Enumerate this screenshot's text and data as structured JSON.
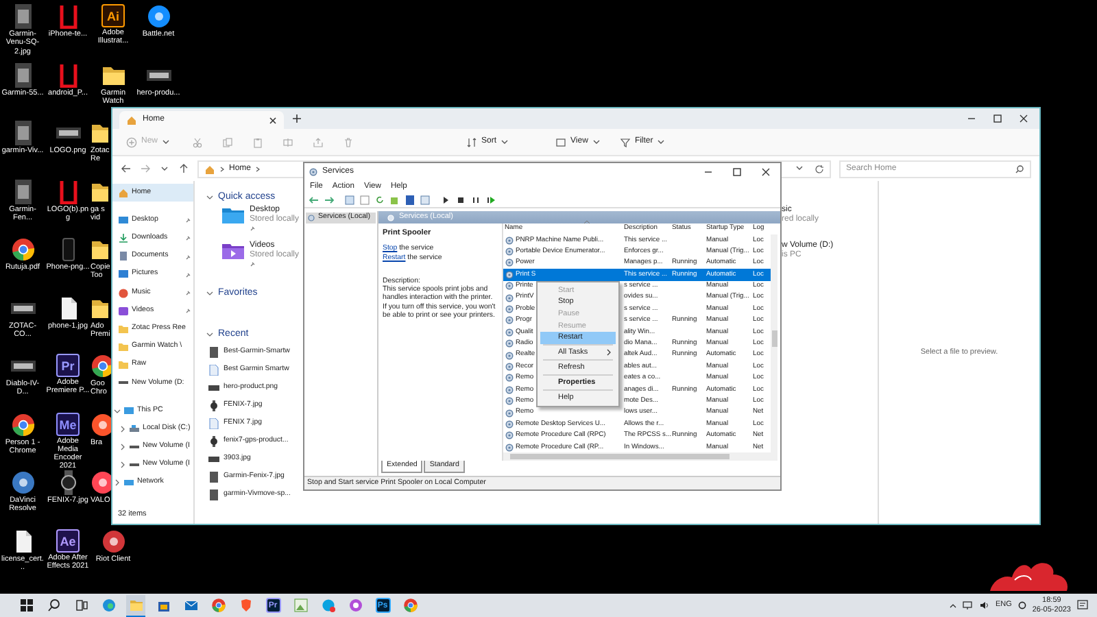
{
  "desktop": {
    "columns": [
      [
        {
          "label": "Garmin-Venu-SQ-2.jpg",
          "kind": "photo",
          "partial": false
        },
        {
          "label": "Garmin-55...",
          "kind": "photo",
          "partial": false
        },
        {
          "label": "garmin-Viv...",
          "kind": "photo",
          "partial": false
        },
        {
          "label": "Garmin-Fen...",
          "kind": "photo",
          "partial": false
        },
        {
          "label": "Rutuja.pdf",
          "kind": "browser",
          "partial": false
        },
        {
          "label": "ZOTAC-CO...",
          "kind": "banner",
          "partial": false
        },
        {
          "label": "Diablo-IV-D...",
          "kind": "banner",
          "partial": false
        },
        {
          "label": "Person 1 - Chrome",
          "kind": "browser",
          "partial": false
        },
        {
          "label": "DaVinci Resolve",
          "kind": "round",
          "color": "#3a78c2",
          "partial": false
        },
        {
          "label": "license_cert...",
          "kind": "doc",
          "partial": false
        }
      ],
      [
        {
          "label": "iPhone-te...",
          "kind": "frame",
          "partial": false
        },
        {
          "label": "android_P...",
          "kind": "frame",
          "partial": false
        },
        {
          "label": "LOGO.png",
          "kind": "banner",
          "partial": false
        },
        {
          "label": "LOGO(b).png",
          "kind": "frame",
          "partial": false
        },
        {
          "label": "Phone-png...",
          "kind": "phone",
          "partial": false
        },
        {
          "label": "phone-1.jpg",
          "kind": "doc",
          "partial": false
        },
        {
          "label": "Adobe Premiere P...",
          "kind": "logo",
          "logo": "Pr",
          "color": "#9999ff",
          "partial": false
        },
        {
          "label": "Adobe Media Encoder 2021",
          "kind": "logo",
          "logo": "Me",
          "color": "#8f8fff",
          "partial": false
        },
        {
          "label": "FENIX-7.jpg",
          "kind": "watch",
          "partial": false
        },
        {
          "label": "Adobe After Effects 2021",
          "kind": "logo",
          "logo": "Ae",
          "color": "#b09aff",
          "partial": false
        }
      ],
      [
        {
          "label": "Adobe Illustrat...",
          "kind": "logo",
          "logo": "Ai",
          "color": "#ff9a00",
          "partial": false
        },
        {
          "label": "Garmin Watch",
          "kind": "folder",
          "partial": false
        },
        {
          "label": "Zotac Re",
          "kind": "folder",
          "partial": true
        },
        {
          "label": "ga s vid",
          "kind": "folder",
          "partial": true
        },
        {
          "label": "Copie Too",
          "kind": "folder",
          "partial": true
        },
        {
          "label": "Ado Premi",
          "kind": "folder",
          "partial": true
        },
        {
          "label": "Goo Chro",
          "kind": "browser",
          "partial": true
        },
        {
          "label": "Bra",
          "kind": "round",
          "color": "#fb542b",
          "partial": true
        },
        {
          "label": "VALO",
          "kind": "round",
          "color": "#ff4655",
          "partial": true
        },
        {
          "label": "Riot Client",
          "kind": "round",
          "color": "#d13639",
          "partial": false
        }
      ],
      [
        {
          "label": "Battle.net",
          "kind": "round",
          "color": "#148eff",
          "partial": false
        },
        {
          "label": "hero-produ...",
          "kind": "banner",
          "partial": false
        }
      ]
    ]
  },
  "explorer": {
    "tab": {
      "label": "Home"
    },
    "toolbar": [
      {
        "label": "New",
        "kind": "new",
        "disabled": true
      },
      {
        "label": "Sort",
        "kind": "sort",
        "disabled": false
      },
      {
        "label": "View",
        "kind": "view",
        "disabled": false
      },
      {
        "label": "Filter",
        "kind": "filter",
        "disabled": false
      }
    ],
    "address": {
      "crumbs": [
        "Home"
      ]
    },
    "search": {
      "placeholder": "Search Home"
    },
    "nav": [
      {
        "label": "Home",
        "kind": "home",
        "pinned": false,
        "selected": true
      },
      {
        "label": "Desktop",
        "kind": "desktop",
        "pinned": true,
        "selected": false
      },
      {
        "label": "Downloads",
        "kind": "download",
        "pinned": true,
        "selected": false
      },
      {
        "label": "Documents",
        "kind": "documents",
        "pinned": true,
        "selected": false
      },
      {
        "label": "Pictures",
        "kind": "pictures",
        "pinned": true,
        "selected": false
      },
      {
        "label": "Music",
        "kind": "music",
        "pinned": true,
        "selected": false
      },
      {
        "label": "Videos",
        "kind": "videos",
        "pinned": true,
        "selected": false
      },
      {
        "label": "Zotac Press Ree",
        "kind": "folder",
        "pinned": false,
        "selected": false
      },
      {
        "label": "Garmin Watch \\",
        "kind": "folder",
        "pinned": false,
        "selected": false
      },
      {
        "label": "Raw",
        "kind": "folder",
        "pinned": false,
        "selected": false
      },
      {
        "label": "New Volume (D:",
        "kind": "drive",
        "pinned": false,
        "selected": false
      },
      {
        "label": "This PC",
        "kind": "pc",
        "pinned": false,
        "selected": false,
        "expanded": true,
        "children": [
          {
            "label": "Local Disk (C:)",
            "kind": "disk",
            "pinned": false,
            "selected": false,
            "expanded": false
          },
          {
            "label": "New Volume (I",
            "kind": "drive",
            "pinned": false,
            "selected": false,
            "expanded": false
          },
          {
            "label": "New Volume (I",
            "kind": "drive",
            "pinned": false,
            "selected": false,
            "expanded": false
          }
        ]
      },
      {
        "label": "Network",
        "kind": "network",
        "pinned": false,
        "selected": false,
        "expanded": false
      }
    ],
    "status": "32 items",
    "quick_access": {
      "title": "Quick access",
      "items": [
        {
          "name": "Desktop",
          "detail": "Stored locally",
          "kind": "desktop"
        },
        {
          "name": "Videos",
          "detail": "Stored locally",
          "kind": "videos"
        }
      ],
      "partial_items": [
        {
          "name": "sic",
          "detail": "red locally"
        },
        {
          "name": "w Volume (D:)",
          "detail": "is PC"
        }
      ]
    },
    "favorites": {
      "title": "Favorites"
    },
    "recent": {
      "title": "Recent",
      "items": [
        {
          "name": "Best-Garmin-Smartw",
          "kind": "photo"
        },
        {
          "name": "Best Garmin Smartw",
          "kind": "doc"
        },
        {
          "name": "hero-product.png",
          "kind": "banner"
        },
        {
          "name": "FENIX-7.jpg",
          "kind": "watch"
        },
        {
          "name": "FENIX 7.jpg",
          "kind": "doc"
        },
        {
          "name": "fenix7-gps-product...",
          "kind": "watch"
        },
        {
          "name": "3903.jpg",
          "kind": "banner"
        },
        {
          "name": "Garmin-Fenix-7.jpg",
          "kind": "photo"
        },
        {
          "name": "garmin-Vivmove-sp...",
          "kind": "photo"
        }
      ]
    },
    "preview": {
      "text": "Select a file to preview."
    }
  },
  "services": {
    "title": "Services",
    "menu": [
      "File",
      "Action",
      "View",
      "Help"
    ],
    "tree": [
      {
        "label": "Services (Local)",
        "selected": true
      }
    ],
    "pane_title": "Services (Local)",
    "detail": {
      "name": "Print Spooler",
      "actions": [
        {
          "link": "Stop",
          "text": " the service"
        },
        {
          "link": "Restart",
          "text": " the service"
        }
      ],
      "description_label": "Description:",
      "description": "This service spools print jobs and handles interaction with the printer. If you turn off this service, you won't be able to print or see your printers."
    },
    "columns": [
      "Name",
      "Description",
      "Status",
      "Startup Type",
      "Log"
    ],
    "rows": [
      {
        "name": "PNRP Machine Name Publi...",
        "description": "This service ...",
        "status": "",
        "startup": "Manual",
        "log": "Loc",
        "selected": false
      },
      {
        "name": "Portable Device Enumerator...",
        "description": "Enforces gr...",
        "status": "",
        "startup": "Manual (Trig...",
        "log": "Loc",
        "selected": false
      },
      {
        "name": "Power",
        "description": "Manages p...",
        "status": "Running",
        "startup": "Automatic",
        "log": "Loc",
        "selected": false
      },
      {
        "name": "Print S",
        "description": "This service ...",
        "status": "Running",
        "startup": "Automatic",
        "log": "Loc",
        "selected": true
      },
      {
        "name": "Printe",
        "description": "s service ...",
        "status": "",
        "startup": "Manual",
        "log": "Loc",
        "selected": false
      },
      {
        "name": "PrintV",
        "description": "ovides su...",
        "status": "",
        "startup": "Manual (Trig...",
        "log": "Loc",
        "selected": false
      },
      {
        "name": "Proble",
        "description": "s service ...",
        "status": "",
        "startup": "Manual",
        "log": "Loc",
        "selected": false
      },
      {
        "name": "Progr",
        "description": "s service ...",
        "status": "Running",
        "startup": "Manual",
        "log": "Loc",
        "selected": false
      },
      {
        "name": "Qualit",
        "description": "ality Win...",
        "status": "",
        "startup": "Manual",
        "log": "Loc",
        "selected": false
      },
      {
        "name": "Radio",
        "description": "dio Mana...",
        "status": "Running",
        "startup": "Manual",
        "log": "Loc",
        "selected": false
      },
      {
        "name": "Realte",
        "description": "altek Aud...",
        "status": "Running",
        "startup": "Automatic",
        "log": "Loc",
        "selected": false
      },
      {
        "name": "Recor",
        "description": "ables aut...",
        "status": "",
        "startup": "Manual",
        "log": "Loc",
        "selected": false
      },
      {
        "name": "Remo",
        "description": "eates a co...",
        "status": "",
        "startup": "Manual",
        "log": "Loc",
        "selected": false
      },
      {
        "name": "Remo",
        "description": "anages di...",
        "status": "Running",
        "startup": "Automatic",
        "log": "Loc",
        "selected": false
      },
      {
        "name": "Remo",
        "description": "mote Des...",
        "status": "",
        "startup": "Manual",
        "log": "Loc",
        "selected": false
      },
      {
        "name": "Remo",
        "description": "lows user...",
        "status": "",
        "startup": "Manual",
        "log": "Net",
        "selected": false
      },
      {
        "name": "Remote Desktop Services U...",
        "description": "Allows the r...",
        "status": "",
        "startup": "Manual",
        "log": "Loc",
        "selected": false
      },
      {
        "name": "Remote Procedure Call (RPC)",
        "description": "The RPCSS s...",
        "status": "Running",
        "startup": "Automatic",
        "log": "Net",
        "selected": false
      },
      {
        "name": "Remote Procedure Call (RP...",
        "description": "In Windows...",
        "status": "",
        "startup": "Manual",
        "log": "Net",
        "selected": false
      }
    ],
    "context_menu": [
      {
        "label": "Start",
        "disabled": true,
        "selected": false,
        "default": false,
        "submenu": false,
        "separator_after": false
      },
      {
        "label": "Stop",
        "disabled": false,
        "selected": false,
        "default": false,
        "submenu": false,
        "separator_after": false
      },
      {
        "label": "Pause",
        "disabled": true,
        "selected": false,
        "default": false,
        "submenu": false,
        "separator_after": false
      },
      {
        "label": "Resume",
        "disabled": true,
        "selected": false,
        "default": false,
        "submenu": false,
        "separator_after": false
      },
      {
        "label": "Restart",
        "disabled": false,
        "selected": true,
        "default": false,
        "submenu": false,
        "separator_after": true
      },
      {
        "label": "All Tasks",
        "disabled": false,
        "selected": false,
        "default": false,
        "submenu": true,
        "separator_after": true
      },
      {
        "label": "Refresh",
        "disabled": false,
        "selected": false,
        "default": false,
        "submenu": false,
        "separator_after": true
      },
      {
        "label": "Properties",
        "disabled": false,
        "selected": false,
        "default": true,
        "submenu": false,
        "separator_after": true
      },
      {
        "label": "Help",
        "disabled": false,
        "selected": false,
        "default": false,
        "submenu": false,
        "separator_after": false
      }
    ],
    "tabs": [
      {
        "label": "Extended",
        "selected": true
      },
      {
        "label": "Standard",
        "selected": false
      }
    ],
    "status": "Stop and Start service Print Spooler on Local Computer"
  },
  "taskbar": {
    "apps": [
      {
        "kind": "start",
        "active": false
      },
      {
        "kind": "search",
        "active": false
      },
      {
        "kind": "taskview",
        "active": false
      },
      {
        "kind": "edge",
        "active": false
      },
      {
        "kind": "explorer",
        "active": true
      },
      {
        "kind": "store",
        "active": false
      },
      {
        "kind": "mail",
        "active": false
      },
      {
        "kind": "chrome",
        "active": false
      },
      {
        "kind": "brave",
        "active": false
      },
      {
        "kind": "letters",
        "label": "Pr",
        "color": "#9999ff",
        "active": false
      },
      {
        "kind": "photos",
        "active": false
      },
      {
        "kind": "skype",
        "active": false
      },
      {
        "kind": "app",
        "active": false
      },
      {
        "kind": "letters",
        "label": "Ps",
        "color": "#31a8ff",
        "active": false
      },
      {
        "kind": "chrome",
        "active": false
      }
    ],
    "tray": {
      "language": "ENG",
      "time": "18:59",
      "date": "26-05-2023"
    }
  }
}
